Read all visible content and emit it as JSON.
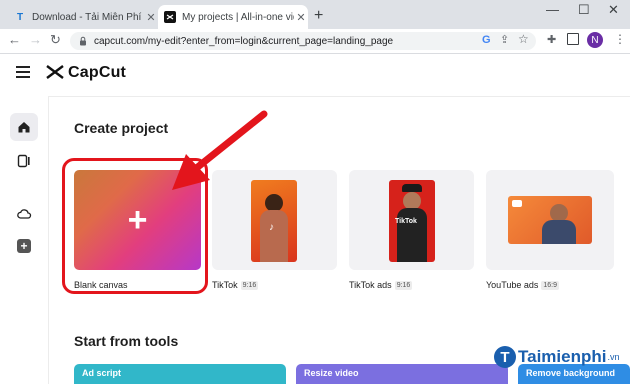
{
  "browser": {
    "tabs": [
      {
        "favicon": "T",
        "title": "Download - Tải Miễn Phí VN - Ph"
      },
      {
        "favicon": "capcut-logo",
        "title": "My projects | All-in-one video ed"
      }
    ],
    "url": "capcut.com/my-edit?enter_from=login&current_page=landing_page",
    "profile_initial": "N"
  },
  "app": {
    "brand": "CapCut"
  },
  "create_project": {
    "heading": "Create project",
    "cards": [
      {
        "label": "Blank canvas",
        "ratio": ""
      },
      {
        "label": "TikTok",
        "ratio": "9:16"
      },
      {
        "label": "TikTok ads",
        "ratio": "9:16"
      },
      {
        "label": "YouTube ads",
        "ratio": "16:9"
      }
    ]
  },
  "tools": {
    "heading": "Start from tools",
    "items": [
      "Ad script",
      "Resize video",
      "Remove background"
    ]
  },
  "watermark": {
    "text": "Taimienphi",
    "sub": ".vn"
  },
  "colors": {
    "accent_red": "#e3151c",
    "tab_bg": "#dee1e6",
    "tools": [
      "#31b7c9",
      "#7b6fe0",
      "#2f8de4"
    ]
  }
}
